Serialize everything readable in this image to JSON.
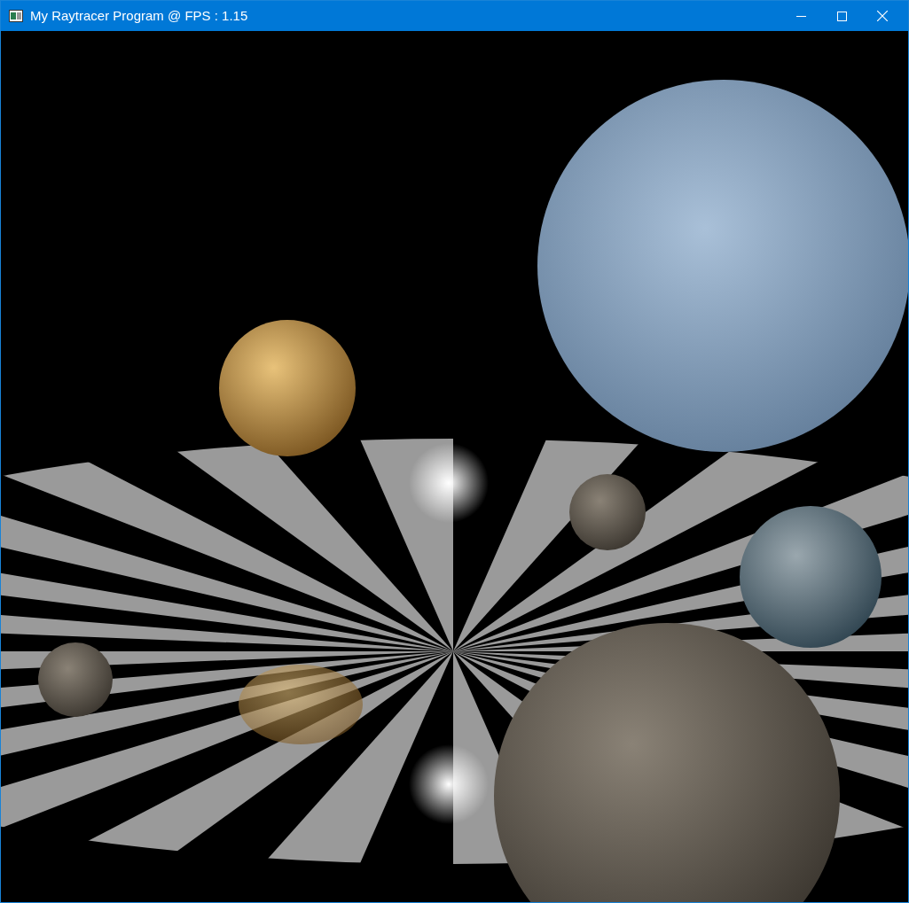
{
  "window": {
    "title": "My Raytracer Program @ FPS : 1.15"
  }
}
